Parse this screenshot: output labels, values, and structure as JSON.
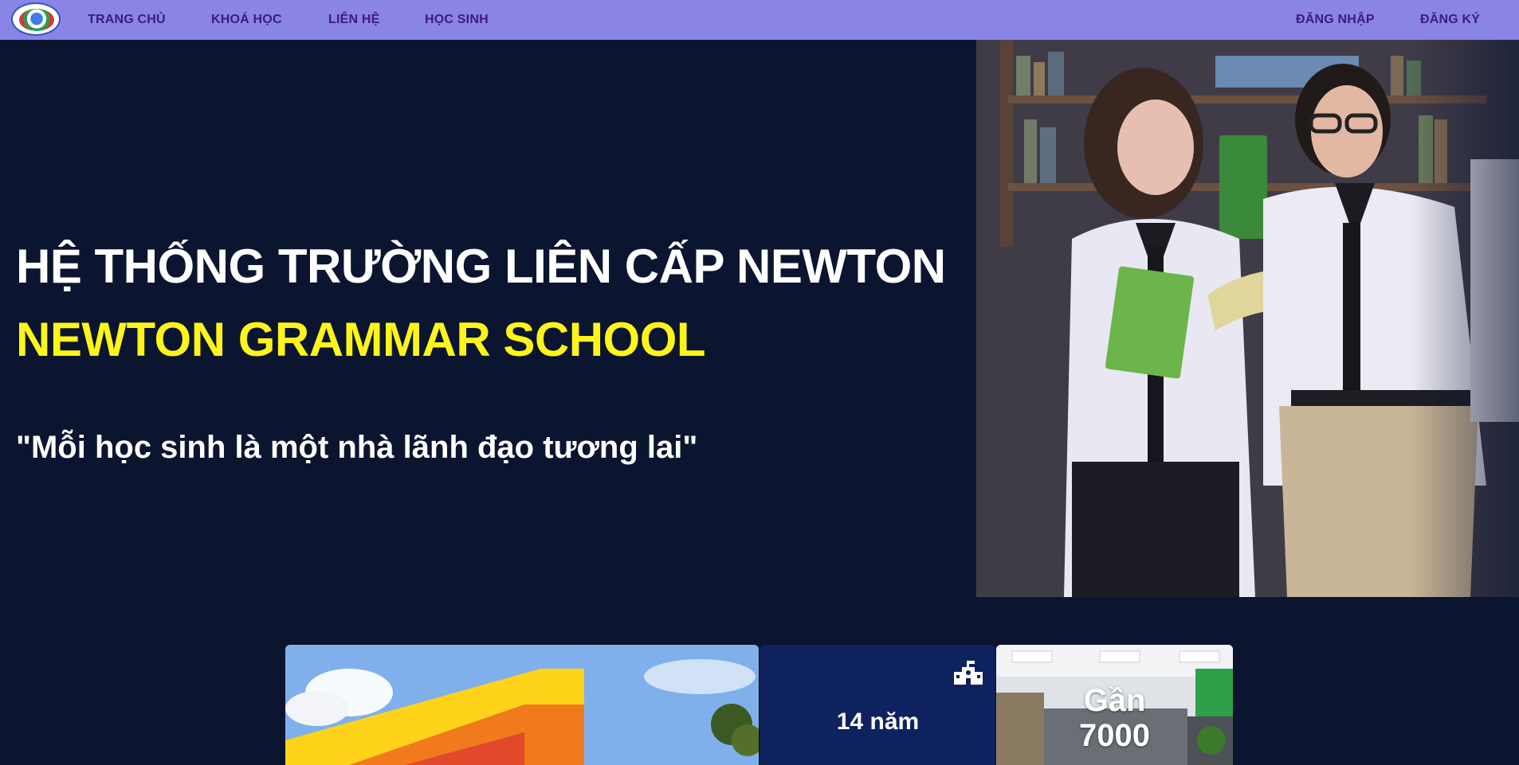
{
  "nav": {
    "logo_alt": "Newton logo",
    "links": [
      {
        "label": "TRANG CHỦ"
      },
      {
        "label": "KHOÁ HỌC"
      },
      {
        "label": "LIÊN HỆ"
      },
      {
        "label": "HỌC SINH"
      }
    ],
    "auth": {
      "login": "ĐĂNG NHẬP",
      "register": "ĐĂNG KÝ"
    }
  },
  "hero": {
    "title": "HỆ THỐNG TRƯỜNG LIÊN CẤP NEWTON",
    "subtitle": "NEWTON GRAMMAR SCHOOL",
    "quote": "\"Mỗi học sinh là một nhà lãnh đạo tương lai\""
  },
  "cards": {
    "stat_years": "14 năm",
    "stat_students_line1": "Gần",
    "stat_students_line2": "7000"
  },
  "colors": {
    "nav_bg": "#8a84e6",
    "nav_text": "#3f1a7e",
    "hero_bg": "#0b1530",
    "subtitle": "#fff41a",
    "stat_card_bg": "#0f2260"
  },
  "icons": {
    "stat_icon": "school-building-icon"
  }
}
